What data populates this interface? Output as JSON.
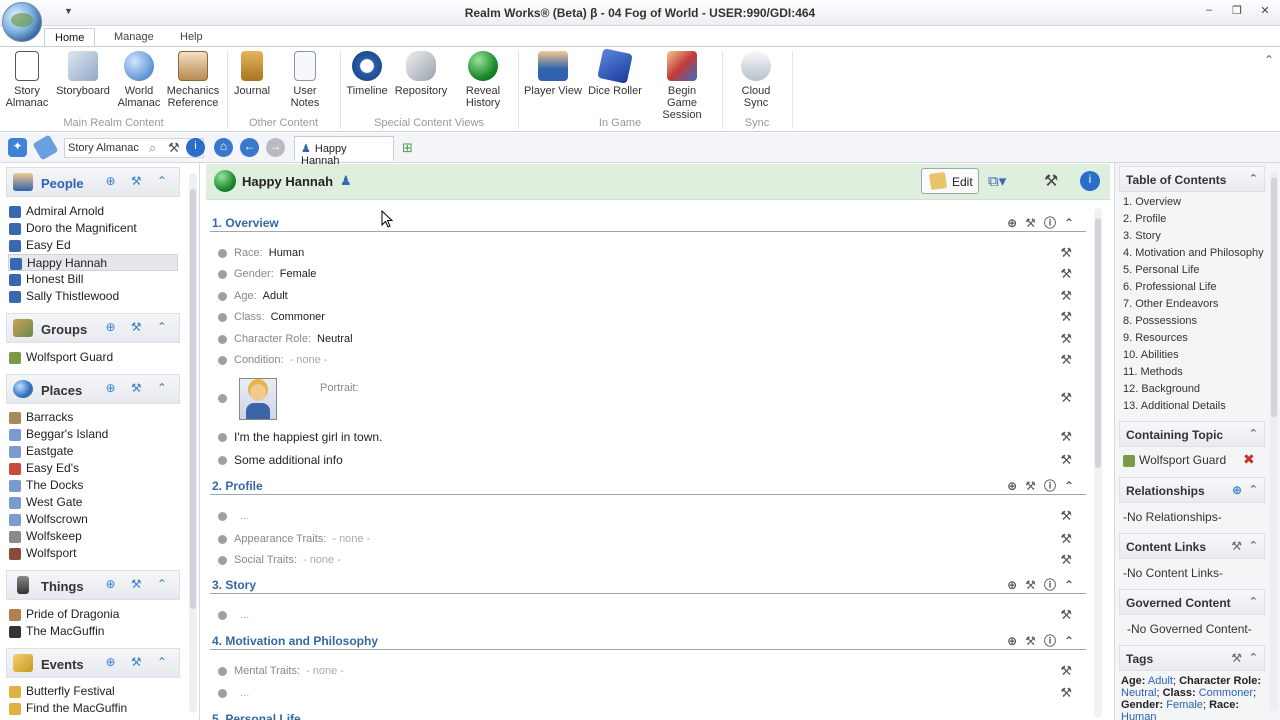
{
  "window": {
    "title": "Realm Works® (Beta) β - 04 Fog of World - USER:990/GDI:464",
    "min": "–",
    "max": "❐",
    "close": "✕",
    "qat": "▼"
  },
  "ribbon": {
    "tabs": [
      "Home",
      "Manage",
      "Help"
    ],
    "buttons": [
      {
        "label": "Story\nAlmanac"
      },
      {
        "label": "Storyboard"
      },
      {
        "label": "World\nAlmanac"
      },
      {
        "label": "Mechanics\nReference"
      },
      {
        "label": "Journal"
      },
      {
        "label": "User Notes"
      },
      {
        "label": "Timeline"
      },
      {
        "label": "Repository"
      },
      {
        "label": "Reveal\nHistory"
      },
      {
        "label": "Player View"
      },
      {
        "label": "Dice Roller"
      },
      {
        "label": "Begin\nGame Session"
      },
      {
        "label": "Cloud Sync"
      }
    ],
    "groups": [
      "Main Realm Content",
      "Other Content",
      "Special Content Views",
      "In Game",
      "Sync"
    ],
    "collapse": "⌃"
  },
  "nav": {
    "search_value": "Story Almanac",
    "search_icon": "⌕",
    "tab_label": "Happy Hannah"
  },
  "sidebar": {
    "people": {
      "label": "People",
      "items": [
        "Admiral Arnold",
        "Doro the Magnificent",
        "Easy Ed",
        "Happy Hannah",
        "Honest Bill",
        "Sally Thistlewood"
      ]
    },
    "groups": {
      "label": "Groups",
      "items": [
        "Wolfsport Guard"
      ]
    },
    "places": {
      "label": "Places",
      "items": [
        "Barracks",
        "Beggar's Island",
        "Eastgate",
        "Easy Ed's",
        "The Docks",
        "West Gate",
        "Wolfscrown",
        "Wolfskeep",
        "Wolfsport"
      ]
    },
    "things": {
      "label": "Things",
      "items": [
        "Pride of Dragonia",
        "The MacGuffin"
      ]
    },
    "events": {
      "label": "Events",
      "items": [
        "Butterfly Festival",
        "Find the MacGuffin"
      ]
    },
    "tools": "⊕ ⚒ ⌃"
  },
  "main": {
    "title": "Happy Hannah",
    "edit_label": "Edit",
    "sections": {
      "overview": "1. Overview",
      "profile": "2. Profile",
      "story": "3. Story",
      "motivation": "4. Motivation and Philosophy",
      "personal": "5. Personal Life"
    },
    "fields": {
      "race_label": "Race:",
      "race_value": "Human",
      "gender_label": "Gender:",
      "gender_value": "Female",
      "age_label": "Age:",
      "age_value": "Adult",
      "class_label": "Class:",
      "class_value": "Commoner",
      "role_label": "Character Role:",
      "role_value": "Neutral",
      "condition_label": "Condition:",
      "condition_value": "- none -",
      "portrait_label": "Portrait:",
      "text1": "I'm the happiest girl in town.",
      "text2": "Some additional info",
      "ellipsis": "...",
      "appearance_label": "Appearance Traits:",
      "appearance_value": "- none -",
      "social_label": "Social Traits:",
      "social_value": "- none -",
      "mental_label": "Mental Traits:",
      "mental_value": "- none -"
    },
    "tool_glyph": "⚒",
    "section_tools": "⊕⚒ⓘ⌃"
  },
  "right": {
    "toc_title": "Table of Contents",
    "toc": [
      "1. Overview",
      "2. Profile",
      "3. Story",
      "4. Motivation and Philosophy",
      "5. Personal Life",
      "6. Professional Life",
      "7. Other Endeavors",
      "8. Possessions",
      "9. Resources",
      "10. Abilities",
      "11. Methods",
      "12. Background",
      "13. Additional Details"
    ],
    "containing_title": "Containing Topic",
    "containing_item": "Wolfsport Guard",
    "relationships_title": "Relationships",
    "relationships_empty": "-No Relationships-",
    "content_links_title": "Content Links",
    "content_links_empty": "-No Content Links-",
    "governed_title": "Governed Content",
    "governed_empty": "-No Governed Content-",
    "tags_title": "Tags",
    "tags": {
      "age_k": "Age:",
      "age_v": "Adult",
      "role_k": "Character Role:",
      "role_v": "Neutral",
      "class_k": "Class:",
      "class_v": "Commoner",
      "gender_k": "Gender:",
      "gender_v": "Female",
      "race_k": "Race:",
      "race_v": "Human"
    }
  },
  "colors": {
    "section": "#3567a6",
    "header_bg": "#deefde",
    "link": "#2b62b8"
  }
}
